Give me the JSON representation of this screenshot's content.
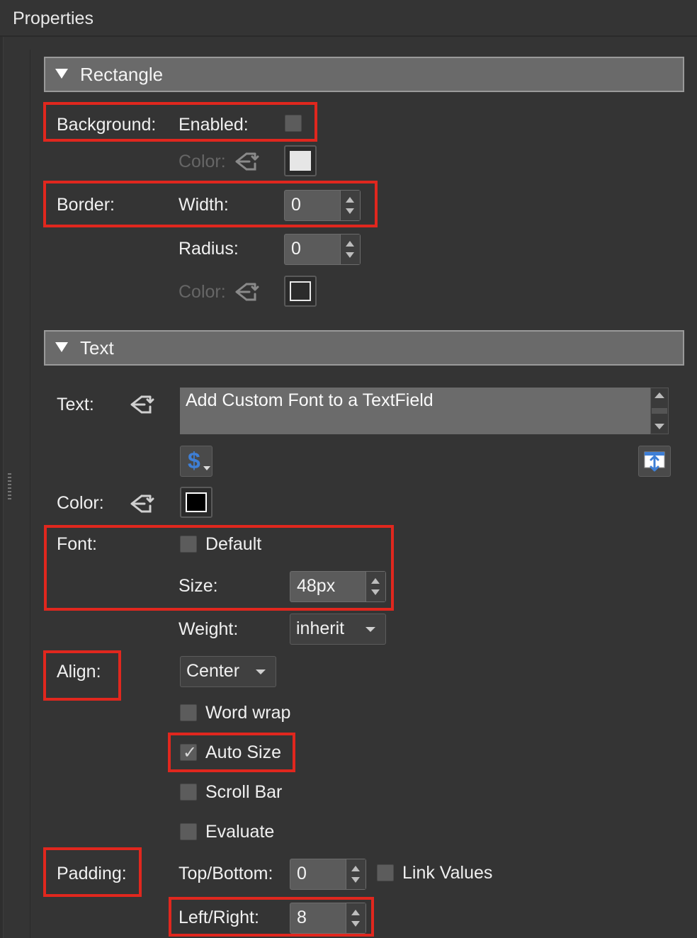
{
  "panel": {
    "title": "Properties"
  },
  "sections": {
    "rectangle": {
      "title": "Rectangle"
    },
    "text": {
      "title": "Text"
    }
  },
  "rectangle": {
    "background_label": "Background:",
    "enabled_label": "Enabled:",
    "bg_color_label": "Color:",
    "bg_color": "#e6e6e6",
    "border_label": "Border:",
    "width_label": "Width:",
    "width_value": "0",
    "radius_label": "Radius:",
    "radius_value": "0",
    "border_color_label": "Color:"
  },
  "text": {
    "text_label": "Text:",
    "text_value": "Add Custom Font to a TextField",
    "color_label": "Color:",
    "color": "#000000",
    "font_label": "Font:",
    "default_label": "Default",
    "size_label": "Size:",
    "size_value": "48px",
    "weight_label": "Weight:",
    "weight_value": "inherit",
    "align_label": "Align:",
    "align_value": "Center",
    "word_wrap_label": "Word wrap",
    "auto_size_label": "Auto Size",
    "scroll_bar_label": "Scroll Bar",
    "evaluate_label": "Evaluate",
    "padding_label": "Padding:",
    "top_bottom_label": "Top/Bottom:",
    "top_bottom_value": "0",
    "link_values_label": "Link Values",
    "left_right_label": "Left/Right:",
    "left_right_value": "8",
    "auto_size_checked": true,
    "dollar_glyph": "$"
  },
  "colors": {
    "highlight": "#e0271e",
    "accent_blue": "#3e7fd6"
  }
}
